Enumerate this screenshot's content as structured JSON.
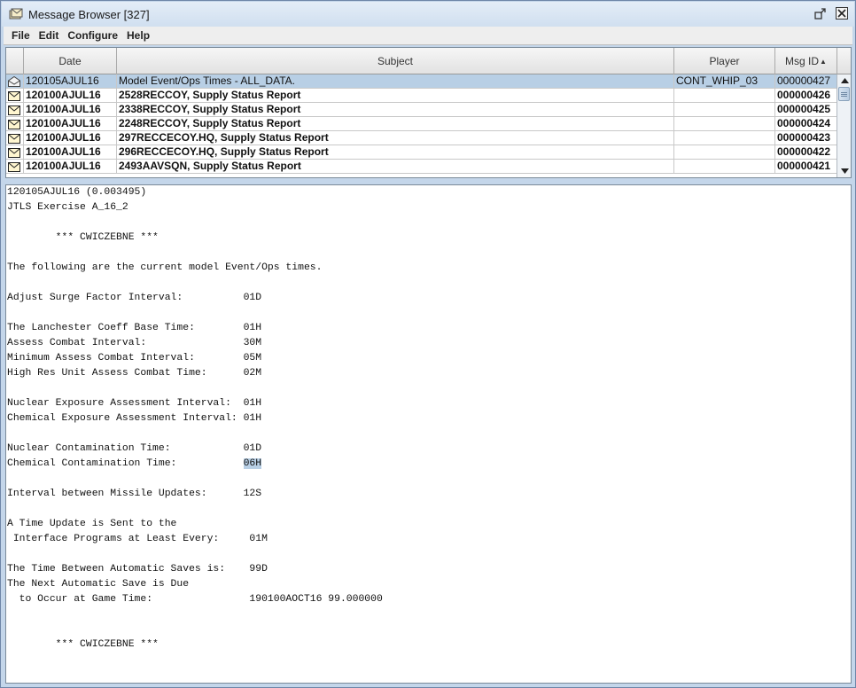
{
  "window": {
    "title": "Message Browser [327]"
  },
  "menu": [
    "File",
    "Edit",
    "Configure",
    "Help"
  ],
  "table": {
    "columns": [
      "Date",
      "Subject",
      "Player",
      "Msg ID"
    ],
    "sorted_column": "Msg ID",
    "rows": [
      {
        "date": "120105AJUL16",
        "subject": "Model Event/Ops Times - ALL_DATA.",
        "player": "CONT_WHIP_03",
        "msgid": "000000427",
        "icon": "envelope-open-icon",
        "unread": false,
        "selected": true
      },
      {
        "date": "120100AJUL16",
        "subject": "2528RECCOY, Supply Status Report",
        "player": "",
        "msgid": "000000426",
        "icon": "envelope-closed-icon",
        "unread": true,
        "selected": false
      },
      {
        "date": "120100AJUL16",
        "subject": "2338RECCOY, Supply Status Report",
        "player": "",
        "msgid": "000000425",
        "icon": "envelope-closed-icon",
        "unread": true,
        "selected": false
      },
      {
        "date": "120100AJUL16",
        "subject": "2248RECCOY, Supply Status Report",
        "player": "",
        "msgid": "000000424",
        "icon": "envelope-closed-icon",
        "unread": true,
        "selected": false
      },
      {
        "date": "120100AJUL16",
        "subject": "297RECCECOY.HQ, Supply Status Report",
        "player": "",
        "msgid": "000000423",
        "icon": "envelope-closed-icon",
        "unread": true,
        "selected": false
      },
      {
        "date": "120100AJUL16",
        "subject": "296RECCECOY.HQ, Supply Status Report",
        "player": "",
        "msgid": "000000422",
        "icon": "envelope-closed-icon",
        "unread": true,
        "selected": false
      },
      {
        "date": "120100AJUL16",
        "subject": "2493AAVSQN, Supply Status Report",
        "player": "",
        "msgid": "000000421",
        "icon": "envelope-closed-icon",
        "unread": true,
        "selected": false
      }
    ]
  },
  "message": {
    "lines": [
      "120105AJUL16 (0.003495)",
      "JTLS Exercise A_16_2",
      "",
      "        *** CWICZEBNE ***",
      "",
      "The following are the current model Event/Ops times.",
      "",
      "Adjust Surge Factor Interval:          01D",
      "",
      "The Lanchester Coeff Base Time:        01H",
      "Assess Combat Interval:                30M",
      "Minimum Assess Combat Interval:        05M",
      "High Res Unit Assess Combat Time:      02M",
      "",
      "Nuclear Exposure Assessment Interval:  01H",
      "Chemical Exposure Assessment Interval: 01H",
      "",
      "Nuclear Contamination Time:            01D",
      "Chemical Contamination Time:           06H",
      "",
      "Interval between Missile Updates:      12S",
      "",
      "A Time Update is Sent to the",
      " Interface Programs at Least Every:     01M",
      "",
      "The Time Between Automatic Saves is:    99D",
      "The Next Automatic Save is Due",
      "  to Occur at Game Time:                190100AOCT16 99.000000",
      "",
      "",
      "        *** CWICZEBNE ***"
    ],
    "highlighted_text": "06H"
  },
  "colors": {
    "selection": "#b8cfe5",
    "frame": "#c4d6ea"
  }
}
